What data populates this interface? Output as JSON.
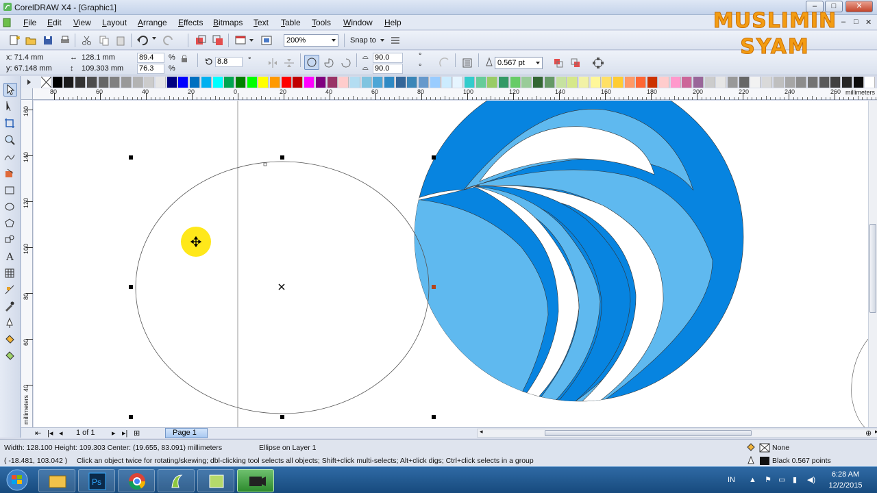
{
  "window": {
    "title": "CorelDRAW X4 - [Graphic1]",
    "min": "–",
    "max": "□",
    "close": "✕"
  },
  "menu": {
    "items": [
      "File",
      "Edit",
      "View",
      "Layout",
      "Arrange",
      "Effects",
      "Bitmaps",
      "Text",
      "Table",
      "Tools",
      "Window",
      "Help"
    ],
    "doc_min": "–",
    "doc_max": "□",
    "doc_close": "✕"
  },
  "toolbar": {
    "zoom_level": "200%",
    "snap_to": "Snap to"
  },
  "property_bar": {
    "x": "x: 71.4 mm",
    "y": "y: 67.148 mm",
    "width": "128.1 mm",
    "height": "109.303 mm",
    "scale_x": "89.4",
    "scale_y": "76.3",
    "pct": "%",
    "rotation": "8.8",
    "deg": "°",
    "start_angle": "90.0",
    "end_angle": "90.0",
    "outline_width": "0.567 pt"
  },
  "colors": {
    "palette": [
      "#ffffff",
      "#000000",
      "#1a1a1a",
      "#333333",
      "#4d4d4d",
      "#666666",
      "#808080",
      "#999999",
      "#b3b3b3",
      "#cccccc",
      "#e6e6e6",
      "#000080",
      "#0000ff",
      "#0070c0",
      "#00b0f0",
      "#00ffff",
      "#00a651",
      "#008000",
      "#00ff00",
      "#ffff00",
      "#ff9900",
      "#ff0000",
      "#c00000",
      "#ff00ff",
      "#800080",
      "#993366",
      "#ffcccc",
      "#b3ddf2",
      "#80c4e0",
      "#4da6d6",
      "#2f8ac4",
      "#336699",
      "#3a86b8",
      "#6699cc",
      "#99ccff",
      "#ccecff",
      "#e6f5ff",
      "#33cccc",
      "#66cc99",
      "#99cc66",
      "#339966",
      "#66cc66",
      "#99cc99",
      "#336633",
      "#669966",
      "#c6e2a0",
      "#d6e88a",
      "#f2f2a6",
      "#fff799",
      "#ffe066",
      "#ffcc33",
      "#ff9966",
      "#ff6633",
      "#cc3300",
      "#ffcccc",
      "#ff99cc",
      "#cc6699",
      "#996699",
      "#cccccc",
      "#e6e6e6",
      "#999999",
      "#666666",
      "#f2f2f2",
      "#d9d9d9",
      "#bfbfbf",
      "#a6a6a6",
      "#8c8c8c",
      "#737373",
      "#595959",
      "#404040",
      "#262626",
      "#0d0d0d",
      "#ffffff"
    ],
    "blue_dark": "#0784e0",
    "blue_light": "#5fb9ef",
    "selection": "#000000",
    "watermark": "#f39c12"
  },
  "ruler": {
    "h_labels": [
      "80",
      "60",
      "40",
      "20",
      "0",
      "20",
      "40",
      "60",
      "80",
      "100",
      "120",
      "140",
      "160",
      "180",
      "200",
      "220",
      "240",
      "260"
    ],
    "h_unit": "millimeters",
    "v_labels": [
      "160",
      "140",
      "120",
      "100",
      "80",
      "60",
      "40"
    ],
    "v_unit": "millimeters"
  },
  "page_nav": {
    "count": "1 of 1",
    "tab": "Page 1"
  },
  "status": {
    "dims": "Width: 128.100  Height: 109.303  Center: (19.655, 83.091)  millimeters",
    "object": "Ellipse on Layer 1",
    "fill": "None",
    "coords": "( -18.481, 103.042 )",
    "hint": "Click an object twice for rotating/skewing; dbl-clicking tool selects all objects; Shift+click multi-selects; Alt+click digs; Ctrl+click selects in a group",
    "outline": "Black  0.567 points"
  },
  "taskbar": {
    "lang": "IN",
    "time": "6:28 AM",
    "date": "12/2/2015"
  },
  "watermark": {
    "line1": "MUSLIMIN",
    "line2": "SYAM"
  }
}
